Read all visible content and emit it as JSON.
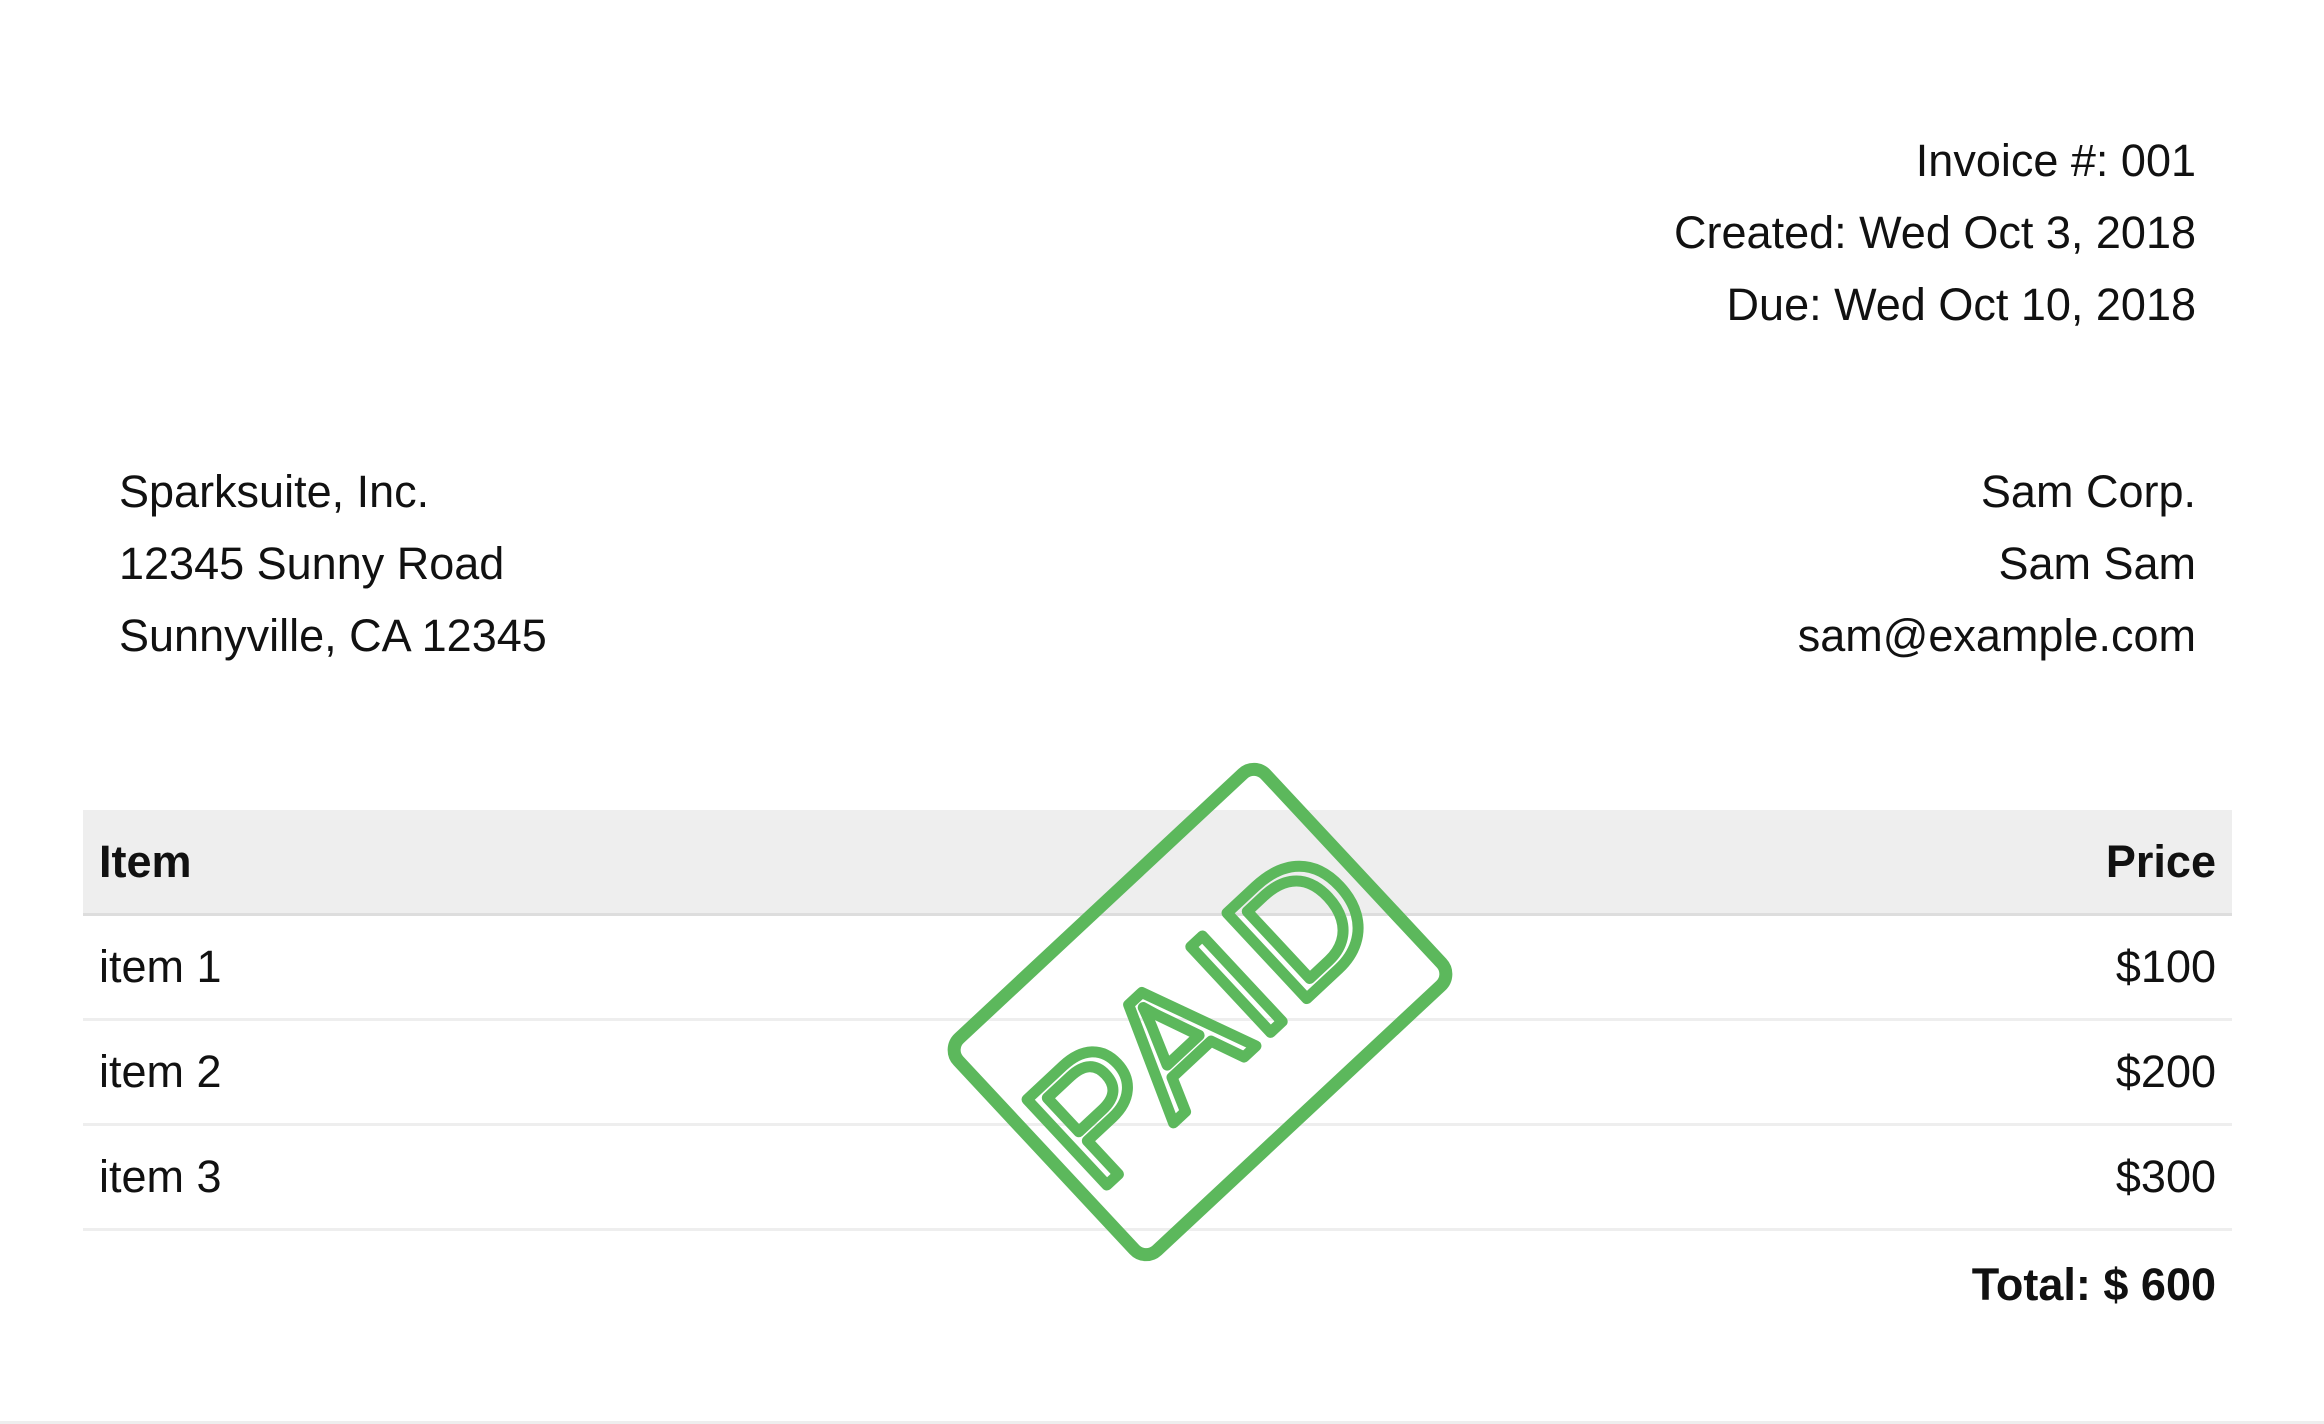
{
  "invoice": {
    "number": "Invoice #: 001",
    "created": "Created: Wed Oct 3, 2018",
    "due": "Due: Wed Oct 10, 2018"
  },
  "company": {
    "name": "Sparksuite, Inc.",
    "street": "12345 Sunny Road",
    "city": "Sunnyville, CA 12345"
  },
  "client": {
    "name": "Sam Corp.",
    "contact": "Sam Sam",
    "email": "sam@example.com"
  },
  "table": {
    "headers": [
      "Item",
      "Price"
    ],
    "rows": [
      {
        "item": "item 1",
        "price": "$100"
      },
      {
        "item": "item 2",
        "price": "$200"
      },
      {
        "item": "item 3",
        "price": "$300"
      }
    ],
    "total": "Total: $ 600"
  },
  "stamp": {
    "text": "PAID",
    "color": "#5cb85c"
  }
}
